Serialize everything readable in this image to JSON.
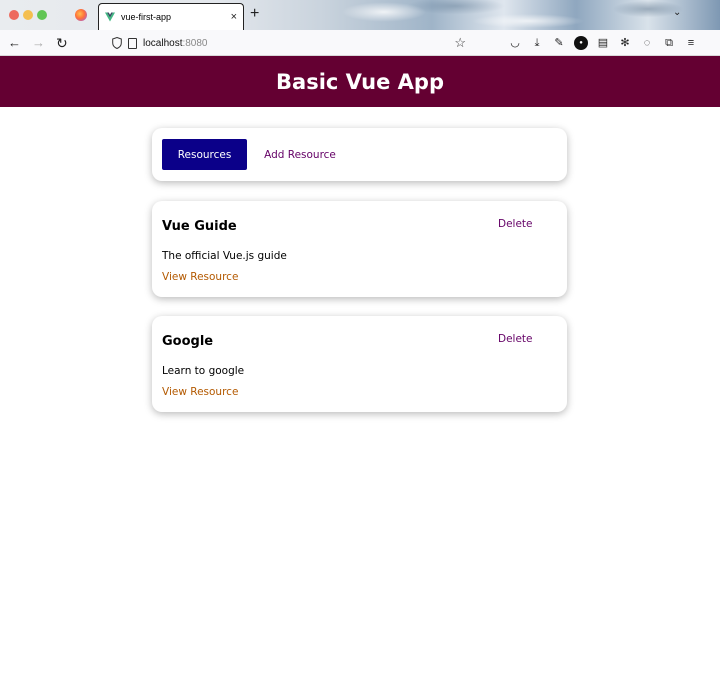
{
  "browser": {
    "tab_title": "vue-first-app",
    "tab_close": "×",
    "new_tab": "+",
    "url_host": "localhost",
    "url_port": ":8080",
    "icons": [
      "back-arrow-icon",
      "forward-arrow-icon",
      "reload-icon",
      "shield-icon",
      "page-icon",
      "star-icon",
      "pocket-icon",
      "download-icon",
      "wrench-icon",
      "extension-icon",
      "notes-icon",
      "gear-icon",
      "puzzle-icon",
      "menu-icon"
    ]
  },
  "header": {
    "title": "Basic Vue App",
    "background": "#640032"
  },
  "controls": {
    "resources_label": "Resources",
    "add_resource_label": "Add Resource",
    "active_color": "#0b0089",
    "link_color": "#640066"
  },
  "resources": [
    {
      "title": "Vue Guide",
      "delete_label": "Delete",
      "description": "The official Vue.js guide",
      "link_label": "View Resource"
    },
    {
      "title": "Google",
      "delete_label": "Delete",
      "description": "Learn to google",
      "link_label": "View Resource"
    }
  ]
}
